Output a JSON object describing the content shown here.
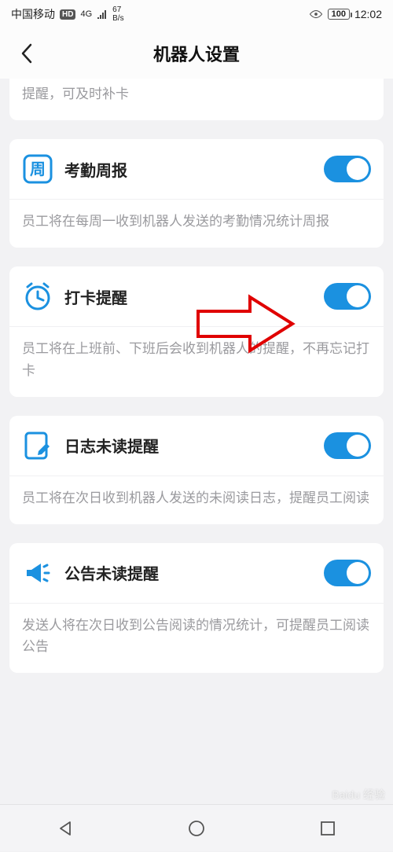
{
  "status": {
    "carrier": "中国移动",
    "hd": "HD",
    "net": "4G",
    "speed_top": "67",
    "speed_bottom": "B/s",
    "battery": "100",
    "time": "12:02"
  },
  "header": {
    "title": "机器人设置"
  },
  "partial_card": {
    "desc": "提醒，可及时补卡"
  },
  "cards": [
    {
      "icon": "week-badge-icon",
      "icon_text": "周",
      "title": "考勤周报",
      "toggle": true,
      "desc": "员工将在每周一收到机器人发送的考勤情况统计周报"
    },
    {
      "icon": "clock-alarm-icon",
      "title": "打卡提醒",
      "toggle": true,
      "desc": "员工将在上班前、下班后会收到机器人的提醒，不再忘记打卡"
    },
    {
      "icon": "journal-edit-icon",
      "title": "日志未读提醒",
      "toggle": true,
      "desc": "员工将在次日收到机器人发送的未阅读日志，提醒员工阅读"
    },
    {
      "icon": "megaphone-icon",
      "title": "公告未读提醒",
      "toggle": true,
      "desc": "发送人将在次日收到公告阅读的情况统计，可提醒员工阅读公告"
    }
  ],
  "watermark": "Baidu 经验"
}
